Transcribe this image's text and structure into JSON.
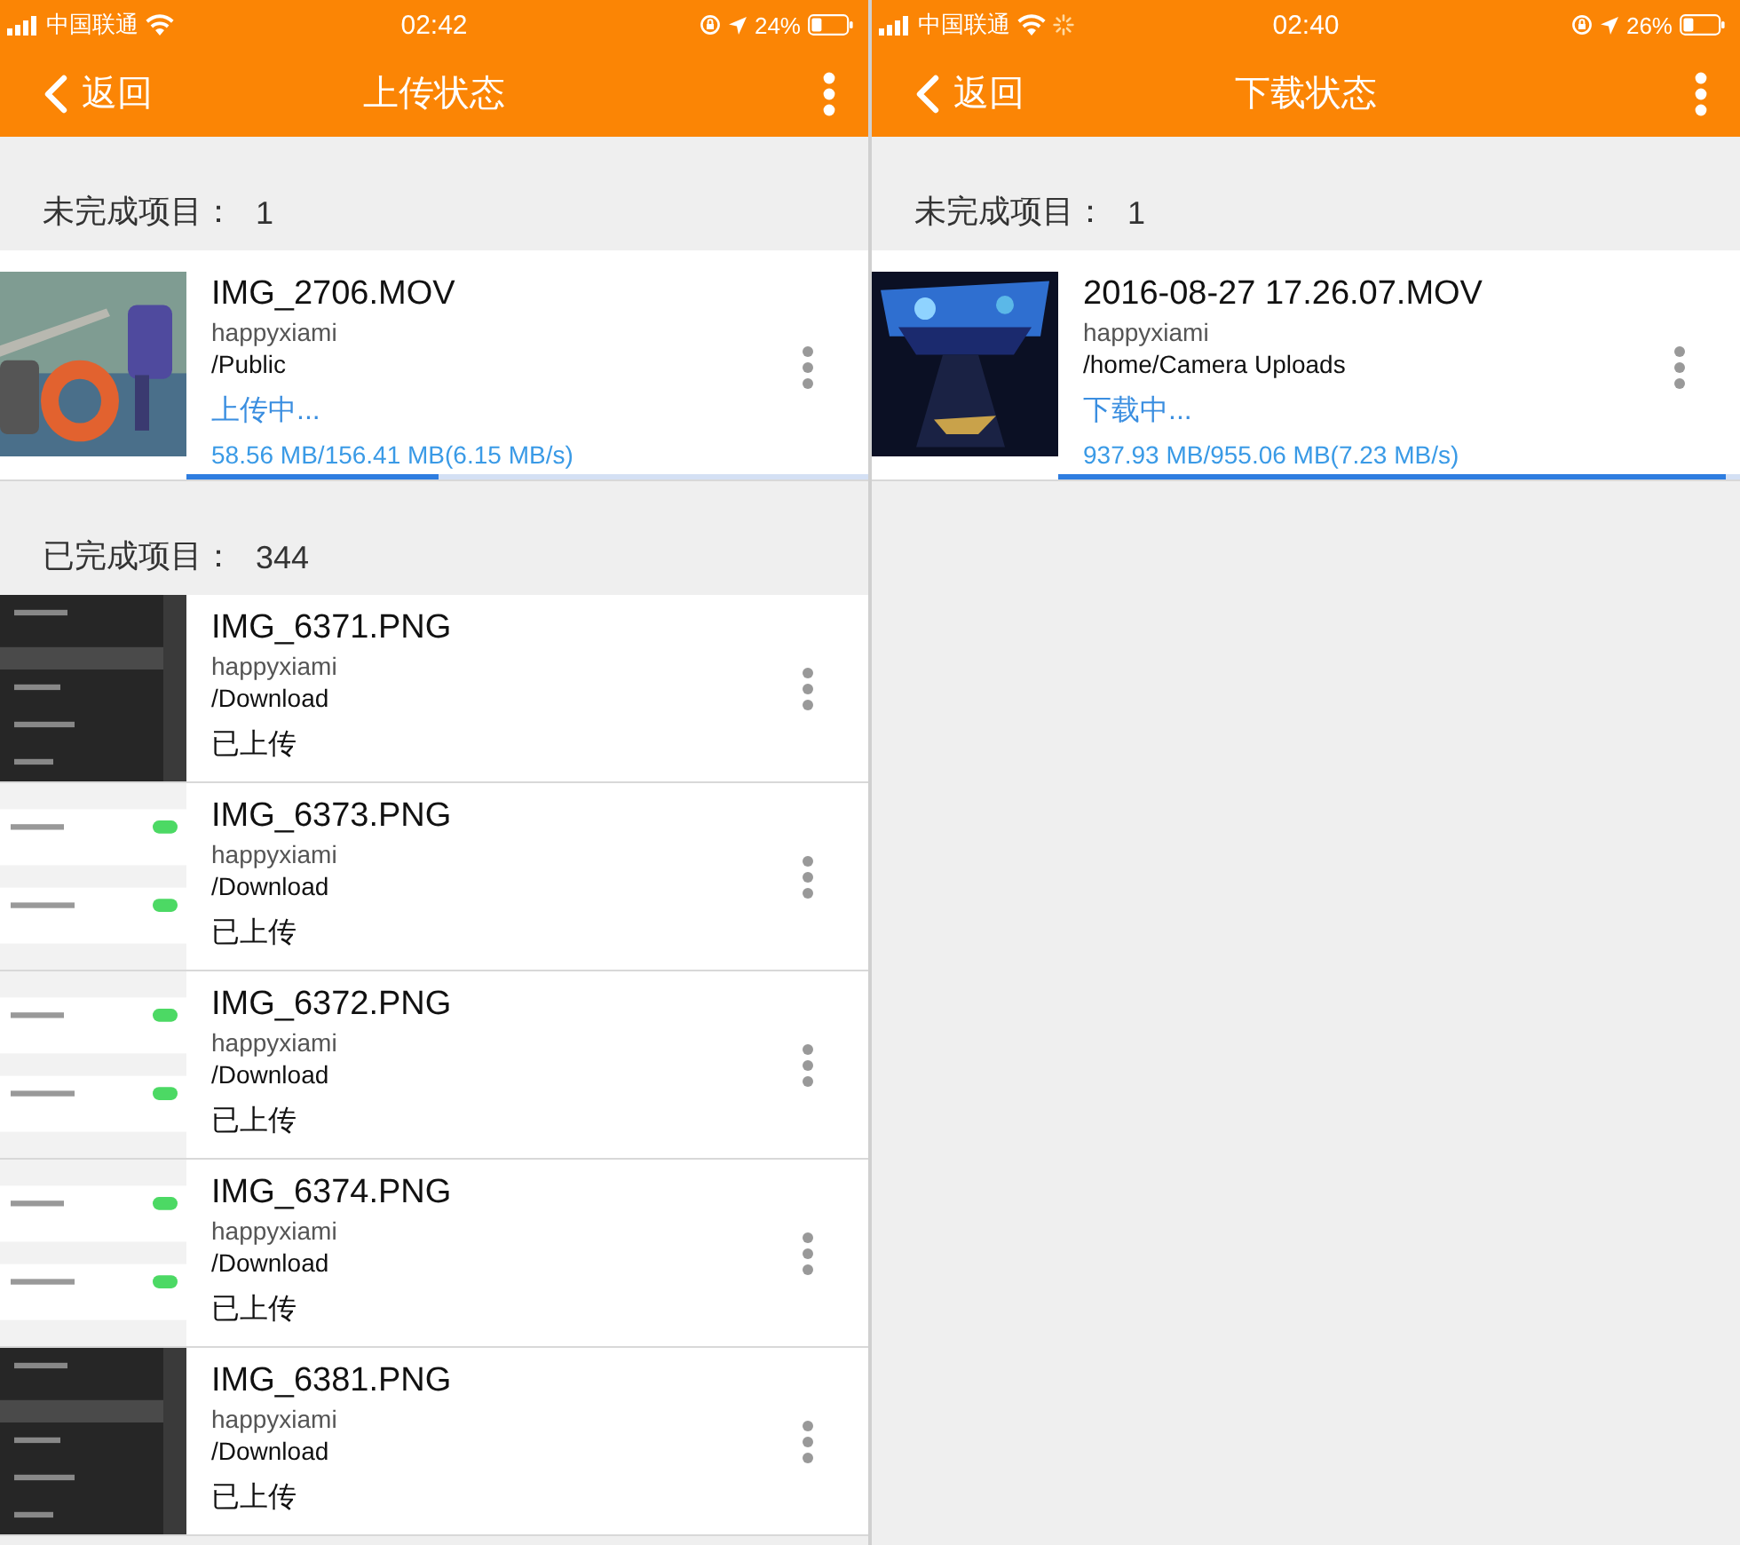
{
  "panels": [
    {
      "status_bar": {
        "carrier": "中国联通",
        "time": "02:42",
        "battery": "24%",
        "activity": false
      },
      "nav": {
        "back": "返回",
        "title": "上传状态"
      },
      "sections": [
        {
          "label": "未完成项目：",
          "count": "1",
          "items": [
            {
              "kind": "active",
              "name": "IMG_2706.MOV",
              "user": "happyxiami",
              "path": "/Public",
              "status": "上传中...",
              "transfer": "58.56 MB/156.41 MB(6.15 MB/s)",
              "level": 0.37
            }
          ]
        },
        {
          "label": "已完成项目：",
          "count": "344",
          "items": [
            {
              "kind": "done",
              "name": "IMG_6371.PNG",
              "user": "happyxiami",
              "path": "/Download",
              "status": "已上传"
            },
            {
              "kind": "done",
              "name": "IMG_6373.PNG",
              "user": "happyxiami",
              "path": "/Download",
              "status": "已上传"
            },
            {
              "kind": "done",
              "name": "IMG_6372.PNG",
              "user": "happyxiami",
              "path": "/Download",
              "status": "已上传"
            },
            {
              "kind": "done",
              "name": "IMG_6374.PNG",
              "user": "happyxiami",
              "path": "/Download",
              "status": "已上传"
            },
            {
              "kind": "done",
              "name": "IMG_6381.PNG",
              "user": "happyxiami",
              "path": "/Download",
              "status": "已上传"
            }
          ]
        }
      ]
    },
    {
      "status_bar": {
        "carrier": "中国联通",
        "time": "02:40",
        "battery": "26%",
        "activity": true
      },
      "nav": {
        "back": "返回",
        "title": "下载状态"
      },
      "sections": [
        {
          "label": "未完成项目：",
          "count": "1",
          "items": [
            {
              "kind": "active",
              "name": "2016-08-27 17.26.07.MOV",
              "user": "happyxiami",
              "path": "/home/Camera Uploads",
              "status": "下载中...",
              "transfer": "937.93 MB/955.06 MB(7.23 MB/s)",
              "level": 0.98
            }
          ]
        }
      ]
    }
  ]
}
